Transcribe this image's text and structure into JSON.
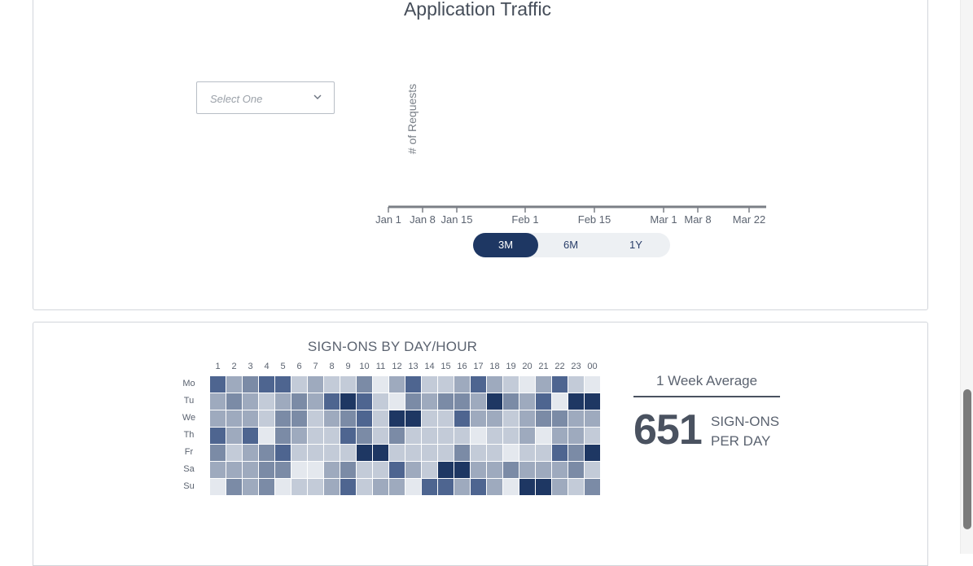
{
  "traffic": {
    "title": "Application Traffic",
    "select_placeholder": "Select One",
    "y_axis_label": "# of Requests",
    "x_ticks": [
      "Jan 1",
      "Jan 8",
      "Jan 15",
      "Feb 1",
      "Feb 15",
      "Mar 1",
      "Mar 8",
      "Mar 22"
    ],
    "ranges": [
      {
        "label": "3M",
        "active": true
      },
      {
        "label": "6M",
        "active": false
      },
      {
        "label": "1Y",
        "active": false
      }
    ]
  },
  "signons": {
    "title": "SIGN-ONS BY DAY/HOUR",
    "hours": [
      "1",
      "2",
      "3",
      "4",
      "5",
      "6",
      "7",
      "8",
      "9",
      "10",
      "11",
      "12",
      "13",
      "14",
      "15",
      "16",
      "17",
      "18",
      "19",
      "20",
      "21",
      "22",
      "23",
      "00"
    ],
    "days": [
      "Mo",
      "Tu",
      "We",
      "Th",
      "Fr",
      "Sa",
      "Su"
    ],
    "levels": [
      [
        4,
        2,
        3,
        4,
        4,
        1,
        2,
        1,
        1,
        3,
        0,
        2,
        4,
        1,
        1,
        2,
        4,
        2,
        1,
        0,
        2,
        4,
        1,
        0
      ],
      [
        2,
        3,
        2,
        1,
        2,
        3,
        2,
        4,
        5,
        4,
        1,
        0,
        3,
        2,
        3,
        3,
        2,
        5,
        3,
        2,
        4,
        0,
        5,
        5
      ],
      [
        2,
        2,
        2,
        1,
        3,
        3,
        1,
        2,
        3,
        4,
        1,
        5,
        5,
        1,
        1,
        4,
        2,
        2,
        1,
        2,
        3,
        3,
        2,
        2
      ],
      [
        4,
        2,
        4,
        0,
        3,
        2,
        1,
        1,
        4,
        3,
        1,
        3,
        1,
        1,
        1,
        1,
        0,
        1,
        1,
        2,
        0,
        2,
        2,
        1
      ],
      [
        3,
        1,
        2,
        3,
        4,
        1,
        1,
        1,
        1,
        5,
        5,
        1,
        1,
        1,
        1,
        3,
        1,
        1,
        0,
        1,
        1,
        4,
        3,
        5
      ],
      [
        2,
        2,
        2,
        3,
        3,
        0,
        0,
        2,
        3,
        1,
        1,
        4,
        2,
        1,
        5,
        5,
        2,
        2,
        3,
        2,
        2,
        2,
        3,
        1
      ],
      [
        0,
        3,
        2,
        3,
        0,
        1,
        1,
        2,
        4,
        1,
        2,
        2,
        0,
        4,
        4,
        2,
        4,
        2,
        0,
        5,
        5,
        2,
        1,
        3
      ]
    ],
    "palette": [
      "#e4e8ee",
      "#c3cbd8",
      "#9eaabe",
      "#7b8ba6",
      "#4e6590",
      "#1e3763"
    ],
    "average_title": "1 Week Average",
    "average_value": "651",
    "average_unit_line1": "SIGN-ONS",
    "average_unit_line2": "PER DAY"
  }
}
